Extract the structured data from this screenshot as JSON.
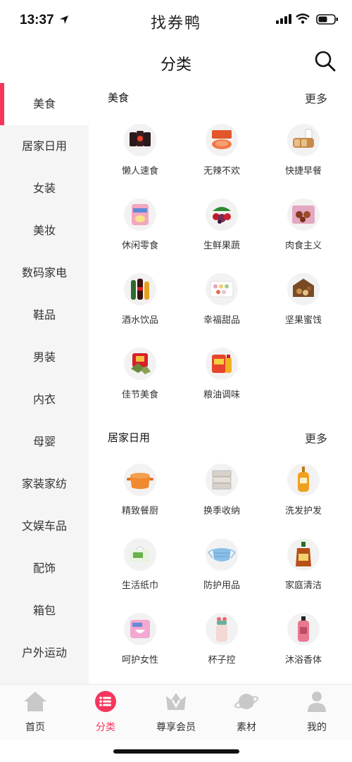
{
  "status": {
    "time": "13:37",
    "app_name": "找券鸭"
  },
  "header": {
    "title": "分类"
  },
  "sidebar": {
    "items": [
      {
        "label": "美食",
        "active": true
      },
      {
        "label": "居家日用"
      },
      {
        "label": "女装"
      },
      {
        "label": "美妆"
      },
      {
        "label": "数码家电"
      },
      {
        "label": "鞋品"
      },
      {
        "label": "男装"
      },
      {
        "label": "内衣"
      },
      {
        "label": "母婴"
      },
      {
        "label": "家装家纺"
      },
      {
        "label": "文娱车品"
      },
      {
        "label": "配饰"
      },
      {
        "label": "箱包"
      },
      {
        "label": "户外运动"
      }
    ]
  },
  "sections": [
    {
      "title": "美食",
      "more": "更多",
      "items": [
        {
          "label": "懒人速食",
          "icon": "instant-food-icon"
        },
        {
          "label": "无辣不欢",
          "icon": "spicy-snack-icon"
        },
        {
          "label": "快捷早餐",
          "icon": "breakfast-icon"
        },
        {
          "label": "休闲零食",
          "icon": "snack-icon"
        },
        {
          "label": "生鲜果蔬",
          "icon": "fruit-veg-icon"
        },
        {
          "label": "肉食主义",
          "icon": "meat-icon"
        },
        {
          "label": "酒水饮品",
          "icon": "drinks-icon"
        },
        {
          "label": "幸福甜品",
          "icon": "dessert-icon"
        },
        {
          "label": "坚果蜜饯",
          "icon": "nuts-icon"
        },
        {
          "label": "佳节美食",
          "icon": "festival-food-icon"
        },
        {
          "label": "粮油调味",
          "icon": "grain-oil-icon"
        }
      ]
    },
    {
      "title": "居家日用",
      "more": "更多",
      "items": [
        {
          "label": "精致餐厨",
          "icon": "cookware-icon"
        },
        {
          "label": "换季收纳",
          "icon": "storage-icon"
        },
        {
          "label": "洗发护发",
          "icon": "shampoo-icon"
        },
        {
          "label": "生活纸巾",
          "icon": "tissue-icon"
        },
        {
          "label": "防护用品",
          "icon": "mask-icon"
        },
        {
          "label": "家庭清洁",
          "icon": "cleaner-icon"
        },
        {
          "label": "呵护女性",
          "icon": "feminine-care-icon"
        },
        {
          "label": "杯子控",
          "icon": "cup-icon"
        },
        {
          "label": "沐浴香体",
          "icon": "body-wash-icon"
        }
      ]
    }
  ],
  "tabbar": [
    {
      "label": "首页",
      "icon": "home-icon"
    },
    {
      "label": "分类",
      "icon": "category-icon",
      "active": true
    },
    {
      "label": "尊享会员",
      "icon": "vip-icon"
    },
    {
      "label": "素材",
      "icon": "planet-icon"
    },
    {
      "label": "我的",
      "icon": "profile-icon"
    }
  ],
  "colors": {
    "accent": "#f5365c",
    "sidebar_bg": "#f5f5f5"
  }
}
